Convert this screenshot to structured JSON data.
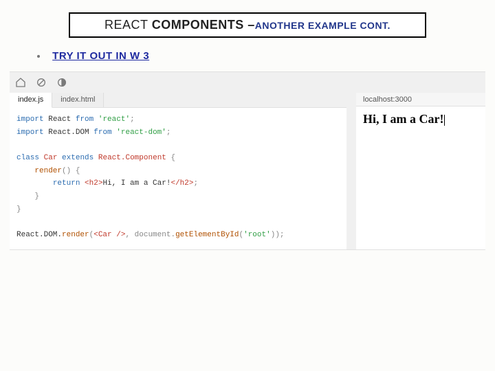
{
  "title": {
    "part1": "REACT ",
    "part2": "COMPONENTS –",
    "part3": "ANOTHER EXAMPLE CONT."
  },
  "bullet": {
    "link_text": "TRY IT OUT IN W 3"
  },
  "editor": {
    "tabs": [
      "index.js",
      "index.html"
    ],
    "active_tab_index": 0,
    "address": "localhost:3000",
    "code": {
      "l1_kw1": "import",
      "l1_id1": "React",
      "l1_kw2": "from",
      "l1_str1": "'react'",
      "l1_end": ";",
      "l2_kw1": "import",
      "l2_id1": "React.DOM",
      "l2_kw2": "from",
      "l2_str1": "'react-dom'",
      "l2_end": ";",
      "l4_kw1": "class",
      "l4_cls": "Car",
      "l4_kw2": "extends",
      "l4_sup": "React.Component",
      "l4_brace": " {",
      "l5_fn": "render",
      "l5_rest": "() {",
      "l6_kw": "return",
      "l6_open": "<h2>",
      "l6_txt": "Hi, I am a Car!",
      "l6_close": "</h2>",
      "l6_end": ";",
      "l7": "}",
      "l8": "}",
      "l10_a": "React.DOM.",
      "l10_fn": "render",
      "l10_b": "(",
      "l10_jsx": "<Car />",
      "l10_c": ", document.",
      "l10_fn2": "getElementById",
      "l10_d": "(",
      "l10_str": "'root'",
      "l10_e": "));"
    },
    "preview": {
      "heading": "Hi, I am a Car!"
    }
  }
}
